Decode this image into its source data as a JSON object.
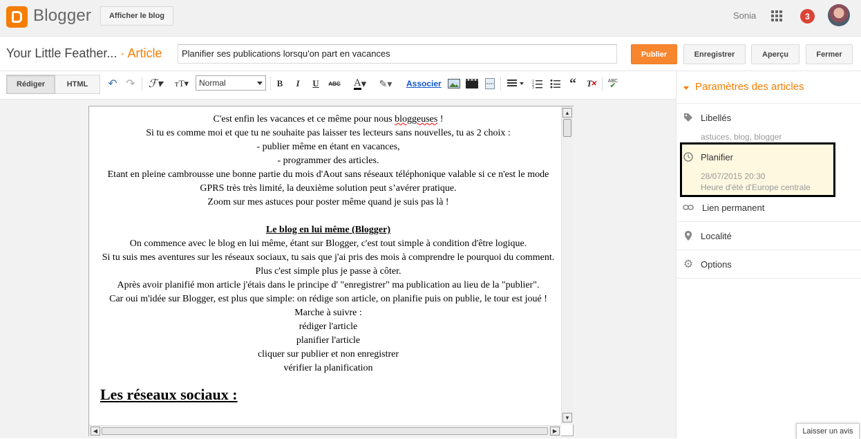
{
  "app": {
    "name": "Blogger",
    "view_blog_label": "Afficher le blog"
  },
  "account": {
    "user_name": "Sonia",
    "notifications": "3"
  },
  "editor": {
    "blog_title": "Your Little Feather...",
    "separator": "·",
    "section": "Article",
    "post_title": "Planifier ses publications lorsqu'on part en vacances",
    "buttons": {
      "publish": "Publier",
      "save": "Enregistrer",
      "preview": "Aperçu",
      "close": "Fermer"
    }
  },
  "toolbar": {
    "compose_label": "Rédiger",
    "html_label": "HTML",
    "font_size_value": "Normal",
    "bold": "B",
    "italic": "I",
    "underline": "U",
    "strike": "ABC",
    "link_label": "Associer"
  },
  "content": {
    "lines": [
      "C'est enfin les vacances et ce même pour nous bloggeuses !",
      "Si tu es comme moi et que tu ne souhaite pas laisser tes lecteurs sans nouvelles, tu as 2 choix :",
      "- publier même en étant en vacances,",
      "- programmer des articles.",
      "Etant en pleine cambrousse une bonne partie du mois d'Aout sans réseaux téléphonique valable si ce n'est le mode GPRS très très limité, la deuxième solution peut s’avérer pratique.",
      "Zoom sur mes astuces pour poster même quand je suis pas là !"
    ],
    "heading1": "Le blog en lui même (Blogger)",
    "lines2": [
      "On commence avec le blog en lui même, étant sur Blogger, c'est tout simple à condition d'être logique.",
      "Si tu suis mes aventures sur les réseaux sociaux, tu sais que j'ai pris des mois à comprendre le pourquoi du comment. Plus c'est simple plus je passe à côter.",
      "Après avoir planifié mon article j'étais dans le principe d' \"enregistrer\" ma publication au lieu de la \"publier\".",
      "Car oui m'idée sur Blogger, est plus que simple: on rédige son article, on planifie puis on publie, le tour est joué !",
      "Marche à suivre :",
      "rédiger l'article",
      "planifier l'article",
      "cliquer sur publier et non enregistrer",
      "vérifier la planification"
    ],
    "heading2": "Les réseaux sociaux :"
  },
  "sidebar": {
    "title": "Paramètres des articles",
    "labels": {
      "label": "Libellés",
      "value": "astuces, blog, blogger"
    },
    "schedule": {
      "label": "Planifier",
      "date": "28/07/2015 20:30",
      "timezone": "Heure d'été d'Europe centrale"
    },
    "permalink": "Lien permanent",
    "location": "Localité",
    "options": "Options"
  },
  "feedback": {
    "label": "Laisser un avis"
  },
  "colors": {
    "accent": "#f57d00",
    "publish": "#f7862f",
    "notif": "#db4437",
    "highlight_box": "#000000"
  }
}
